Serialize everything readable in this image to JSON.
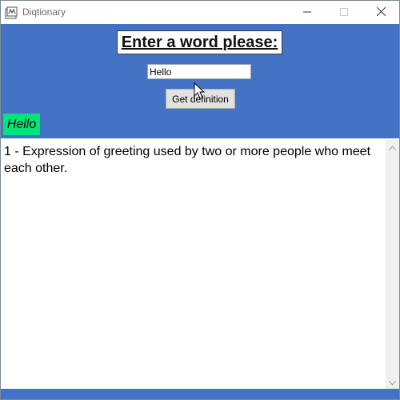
{
  "window": {
    "title": "Diqtionary",
    "controls": [
      "minimize-icon",
      "maximize-icon",
      "close-icon"
    ],
    "accent_color": "#4472c4"
  },
  "form": {
    "heading": "Enter a word please:",
    "input_value": "Hello",
    "button_label": "Get definition"
  },
  "result": {
    "word": "Hello",
    "word_highlight_color": "#00e676",
    "definition": "1 - Expression of greeting used by two or more people who meet each other."
  }
}
